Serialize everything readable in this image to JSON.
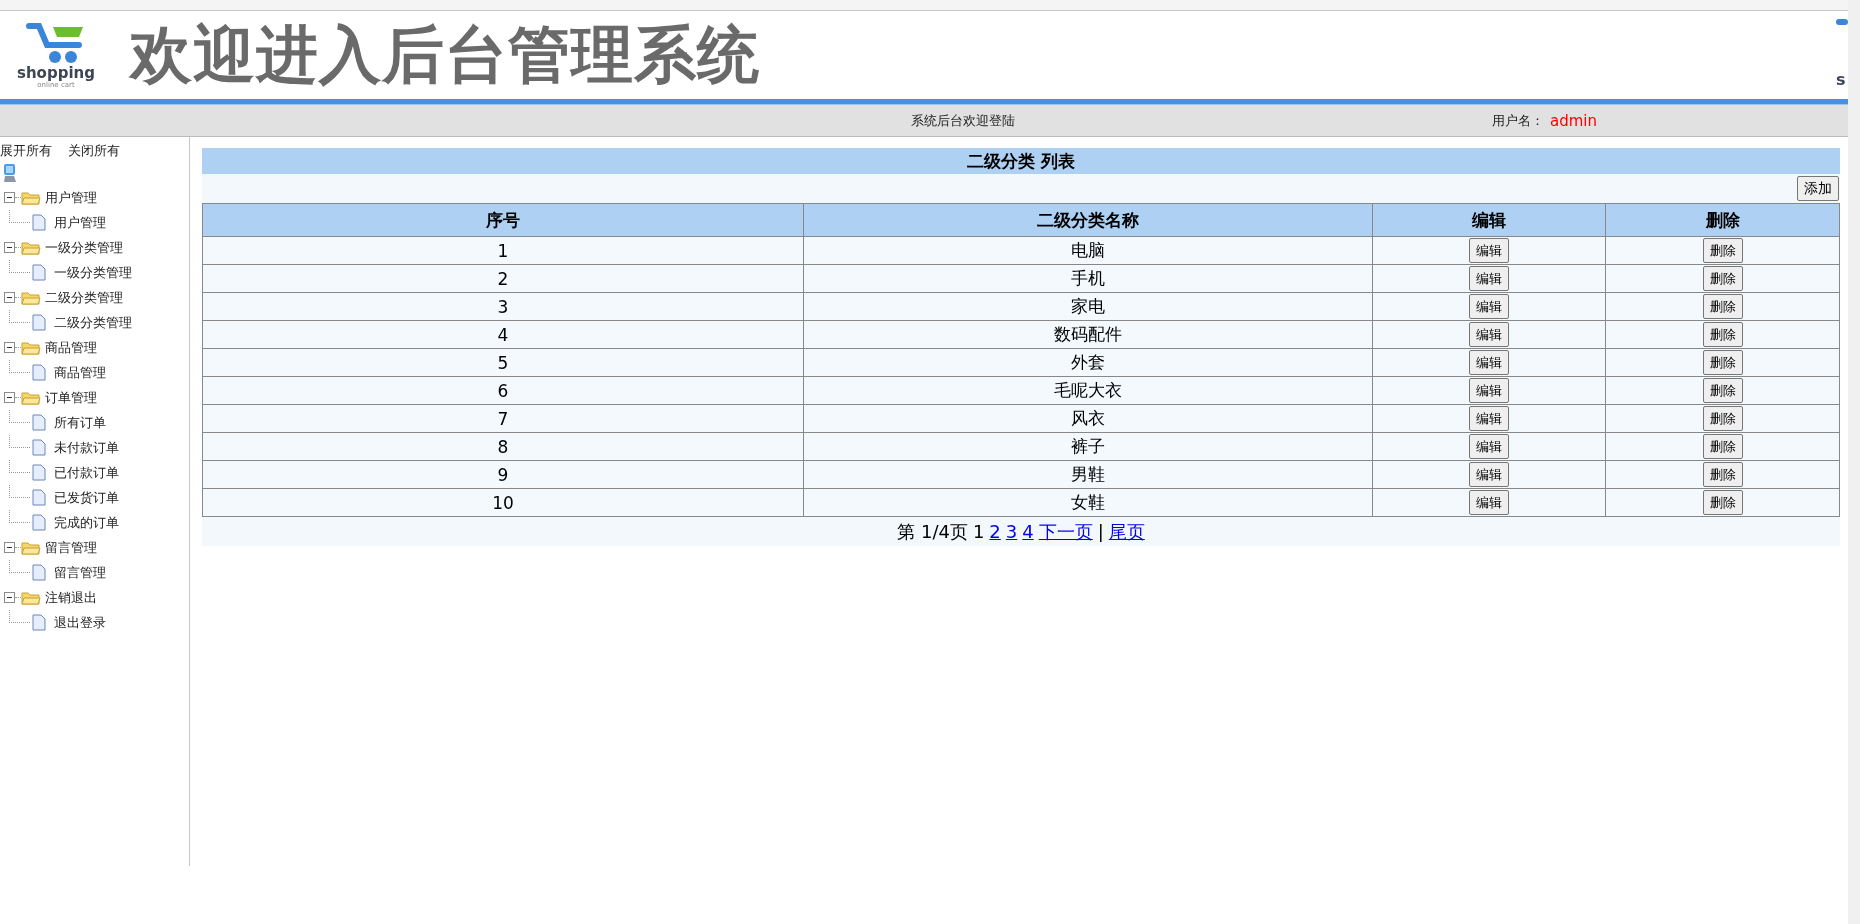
{
  "header": {
    "logo": {
      "name": "shopping",
      "tagline": "online cart"
    },
    "title": "欢迎进入后台管理系统",
    "edge_logo_fragment": "s"
  },
  "info_bar": {
    "welcome": "系统后台欢迎登陆",
    "user_label": "用户名：",
    "user_name": "admin"
  },
  "sidebar": {
    "actions": [
      "展开所有",
      "关闭所有"
    ],
    "tree": [
      {
        "label": "用户管理",
        "expanded": true,
        "children": [
          {
            "label": "用户管理"
          }
        ]
      },
      {
        "label": "一级分类管理",
        "expanded": true,
        "children": [
          {
            "label": "一级分类管理"
          }
        ]
      },
      {
        "label": "二级分类管理",
        "expanded": true,
        "children": [
          {
            "label": "二级分类管理"
          }
        ]
      },
      {
        "label": "商品管理",
        "expanded": true,
        "children": [
          {
            "label": "商品管理"
          }
        ]
      },
      {
        "label": "订单管理",
        "expanded": true,
        "children": [
          {
            "label": "所有订单"
          },
          {
            "label": "未付款订单"
          },
          {
            "label": "已付款订单"
          },
          {
            "label": "已发货订单"
          },
          {
            "label": "完成的订单"
          }
        ]
      },
      {
        "label": "留言管理",
        "expanded": true,
        "children": [
          {
            "label": "留言管理"
          }
        ]
      },
      {
        "label": "注销退出",
        "expanded": true,
        "children": [
          {
            "label": "退出登录"
          }
        ]
      }
    ]
  },
  "panel": {
    "title": "二级分类 列表",
    "add_button": "添加",
    "table": {
      "columns": [
        "序号",
        "二级分类名称",
        "编辑",
        "删除"
      ],
      "rows": [
        {
          "no": "1",
          "name": "电脑",
          "edit": "编辑",
          "delete": "删除"
        },
        {
          "no": "2",
          "name": "手机",
          "edit": "编辑",
          "delete": "删除"
        },
        {
          "no": "3",
          "name": "家电",
          "edit": "编辑",
          "delete": "删除"
        },
        {
          "no": "4",
          "name": "数码配件",
          "edit": "编辑",
          "delete": "删除"
        },
        {
          "no": "5",
          "name": "外套",
          "edit": "编辑",
          "delete": "删除"
        },
        {
          "no": "6",
          "name": "毛呢大衣",
          "edit": "编辑",
          "delete": "删除"
        },
        {
          "no": "7",
          "name": "风衣",
          "edit": "编辑",
          "delete": "删除"
        },
        {
          "no": "8",
          "name": "裤子",
          "edit": "编辑",
          "delete": "删除"
        },
        {
          "no": "9",
          "name": "男鞋",
          "edit": "编辑",
          "delete": "删除"
        },
        {
          "no": "10",
          "name": "女鞋",
          "edit": "编辑",
          "delete": "删除"
        }
      ]
    },
    "pagination": [
      {
        "kind": "text",
        "text": "第 1/4页"
      },
      {
        "kind": "text",
        "text": "1"
      },
      {
        "kind": "link",
        "text": "2"
      },
      {
        "kind": "link",
        "text": "3"
      },
      {
        "kind": "link",
        "text": "4"
      },
      {
        "kind": "link",
        "text": "下一页"
      },
      {
        "kind": "text",
        "text": "|"
      },
      {
        "kind": "link",
        "text": "尾页"
      }
    ]
  }
}
